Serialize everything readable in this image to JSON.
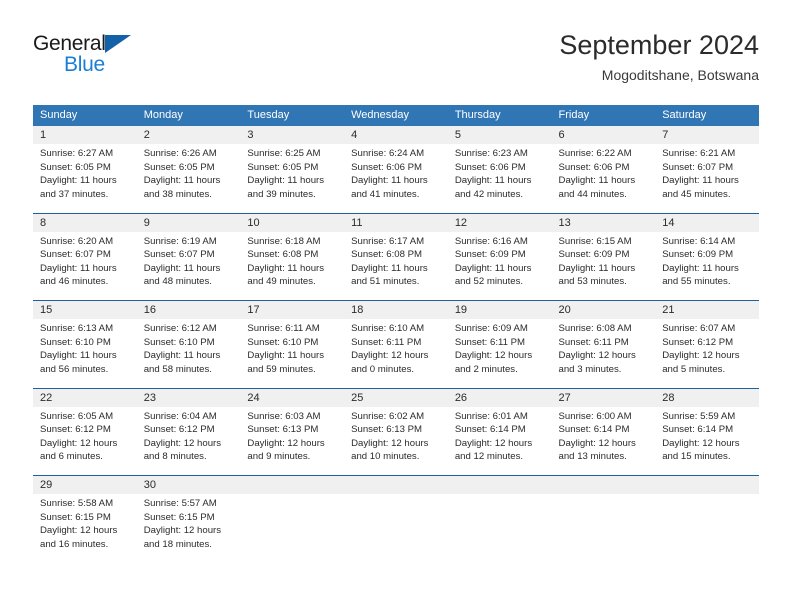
{
  "branding": {
    "name_part1": "General",
    "name_part2": "Blue",
    "triangle_color": "#1362a8",
    "blue_color": "#1a7fd4"
  },
  "header": {
    "title": "September 2024",
    "subtitle": "Mogoditshane, Botswana"
  },
  "theme": {
    "header_row_bg": "#3075b4",
    "day_number_bg": "#f0f0f0",
    "week_divider": "#1f5f9e",
    "text_color": "#2b2b2b"
  },
  "calendar": {
    "day_names": [
      "Sunday",
      "Monday",
      "Tuesday",
      "Wednesday",
      "Thursday",
      "Friday",
      "Saturday"
    ],
    "weeks": [
      [
        {
          "day": "1",
          "sunrise": "Sunrise: 6:27 AM",
          "sunset": "Sunset: 6:05 PM",
          "daylight_1": "Daylight: 11 hours",
          "daylight_2": "and 37 minutes."
        },
        {
          "day": "2",
          "sunrise": "Sunrise: 6:26 AM",
          "sunset": "Sunset: 6:05 PM",
          "daylight_1": "Daylight: 11 hours",
          "daylight_2": "and 38 minutes."
        },
        {
          "day": "3",
          "sunrise": "Sunrise: 6:25 AM",
          "sunset": "Sunset: 6:05 PM",
          "daylight_1": "Daylight: 11 hours",
          "daylight_2": "and 39 minutes."
        },
        {
          "day": "4",
          "sunrise": "Sunrise: 6:24 AM",
          "sunset": "Sunset: 6:06 PM",
          "daylight_1": "Daylight: 11 hours",
          "daylight_2": "and 41 minutes."
        },
        {
          "day": "5",
          "sunrise": "Sunrise: 6:23 AM",
          "sunset": "Sunset: 6:06 PM",
          "daylight_1": "Daylight: 11 hours",
          "daylight_2": "and 42 minutes."
        },
        {
          "day": "6",
          "sunrise": "Sunrise: 6:22 AM",
          "sunset": "Sunset: 6:06 PM",
          "daylight_1": "Daylight: 11 hours",
          "daylight_2": "and 44 minutes."
        },
        {
          "day": "7",
          "sunrise": "Sunrise: 6:21 AM",
          "sunset": "Sunset: 6:07 PM",
          "daylight_1": "Daylight: 11 hours",
          "daylight_2": "and 45 minutes."
        }
      ],
      [
        {
          "day": "8",
          "sunrise": "Sunrise: 6:20 AM",
          "sunset": "Sunset: 6:07 PM",
          "daylight_1": "Daylight: 11 hours",
          "daylight_2": "and 46 minutes."
        },
        {
          "day": "9",
          "sunrise": "Sunrise: 6:19 AM",
          "sunset": "Sunset: 6:07 PM",
          "daylight_1": "Daylight: 11 hours",
          "daylight_2": "and 48 minutes."
        },
        {
          "day": "10",
          "sunrise": "Sunrise: 6:18 AM",
          "sunset": "Sunset: 6:08 PM",
          "daylight_1": "Daylight: 11 hours",
          "daylight_2": "and 49 minutes."
        },
        {
          "day": "11",
          "sunrise": "Sunrise: 6:17 AM",
          "sunset": "Sunset: 6:08 PM",
          "daylight_1": "Daylight: 11 hours",
          "daylight_2": "and 51 minutes."
        },
        {
          "day": "12",
          "sunrise": "Sunrise: 6:16 AM",
          "sunset": "Sunset: 6:09 PM",
          "daylight_1": "Daylight: 11 hours",
          "daylight_2": "and 52 minutes."
        },
        {
          "day": "13",
          "sunrise": "Sunrise: 6:15 AM",
          "sunset": "Sunset: 6:09 PM",
          "daylight_1": "Daylight: 11 hours",
          "daylight_2": "and 53 minutes."
        },
        {
          "day": "14",
          "sunrise": "Sunrise: 6:14 AM",
          "sunset": "Sunset: 6:09 PM",
          "daylight_1": "Daylight: 11 hours",
          "daylight_2": "and 55 minutes."
        }
      ],
      [
        {
          "day": "15",
          "sunrise": "Sunrise: 6:13 AM",
          "sunset": "Sunset: 6:10 PM",
          "daylight_1": "Daylight: 11 hours",
          "daylight_2": "and 56 minutes."
        },
        {
          "day": "16",
          "sunrise": "Sunrise: 6:12 AM",
          "sunset": "Sunset: 6:10 PM",
          "daylight_1": "Daylight: 11 hours",
          "daylight_2": "and 58 minutes."
        },
        {
          "day": "17",
          "sunrise": "Sunrise: 6:11 AM",
          "sunset": "Sunset: 6:10 PM",
          "daylight_1": "Daylight: 11 hours",
          "daylight_2": "and 59 minutes."
        },
        {
          "day": "18",
          "sunrise": "Sunrise: 6:10 AM",
          "sunset": "Sunset: 6:11 PM",
          "daylight_1": "Daylight: 12 hours",
          "daylight_2": "and 0 minutes."
        },
        {
          "day": "19",
          "sunrise": "Sunrise: 6:09 AM",
          "sunset": "Sunset: 6:11 PM",
          "daylight_1": "Daylight: 12 hours",
          "daylight_2": "and 2 minutes."
        },
        {
          "day": "20",
          "sunrise": "Sunrise: 6:08 AM",
          "sunset": "Sunset: 6:11 PM",
          "daylight_1": "Daylight: 12 hours",
          "daylight_2": "and 3 minutes."
        },
        {
          "day": "21",
          "sunrise": "Sunrise: 6:07 AM",
          "sunset": "Sunset: 6:12 PM",
          "daylight_1": "Daylight: 12 hours",
          "daylight_2": "and 5 minutes."
        }
      ],
      [
        {
          "day": "22",
          "sunrise": "Sunrise: 6:05 AM",
          "sunset": "Sunset: 6:12 PM",
          "daylight_1": "Daylight: 12 hours",
          "daylight_2": "and 6 minutes."
        },
        {
          "day": "23",
          "sunrise": "Sunrise: 6:04 AM",
          "sunset": "Sunset: 6:12 PM",
          "daylight_1": "Daylight: 12 hours",
          "daylight_2": "and 8 minutes."
        },
        {
          "day": "24",
          "sunrise": "Sunrise: 6:03 AM",
          "sunset": "Sunset: 6:13 PM",
          "daylight_1": "Daylight: 12 hours",
          "daylight_2": "and 9 minutes."
        },
        {
          "day": "25",
          "sunrise": "Sunrise: 6:02 AM",
          "sunset": "Sunset: 6:13 PM",
          "daylight_1": "Daylight: 12 hours",
          "daylight_2": "and 10 minutes."
        },
        {
          "day": "26",
          "sunrise": "Sunrise: 6:01 AM",
          "sunset": "Sunset: 6:14 PM",
          "daylight_1": "Daylight: 12 hours",
          "daylight_2": "and 12 minutes."
        },
        {
          "day": "27",
          "sunrise": "Sunrise: 6:00 AM",
          "sunset": "Sunset: 6:14 PM",
          "daylight_1": "Daylight: 12 hours",
          "daylight_2": "and 13 minutes."
        },
        {
          "day": "28",
          "sunrise": "Sunrise: 5:59 AM",
          "sunset": "Sunset: 6:14 PM",
          "daylight_1": "Daylight: 12 hours",
          "daylight_2": "and 15 minutes."
        }
      ],
      [
        {
          "day": "29",
          "sunrise": "Sunrise: 5:58 AM",
          "sunset": "Sunset: 6:15 PM",
          "daylight_1": "Daylight: 12 hours",
          "daylight_2": "and 16 minutes."
        },
        {
          "day": "30",
          "sunrise": "Sunrise: 5:57 AM",
          "sunset": "Sunset: 6:15 PM",
          "daylight_1": "Daylight: 12 hours",
          "daylight_2": "and 18 minutes."
        },
        {
          "day": "",
          "sunrise": "",
          "sunset": "",
          "daylight_1": "",
          "daylight_2": ""
        },
        {
          "day": "",
          "sunrise": "",
          "sunset": "",
          "daylight_1": "",
          "daylight_2": ""
        },
        {
          "day": "",
          "sunrise": "",
          "sunset": "",
          "daylight_1": "",
          "daylight_2": ""
        },
        {
          "day": "",
          "sunrise": "",
          "sunset": "",
          "daylight_1": "",
          "daylight_2": ""
        },
        {
          "day": "",
          "sunrise": "",
          "sunset": "",
          "daylight_1": "",
          "daylight_2": ""
        }
      ]
    ]
  }
}
